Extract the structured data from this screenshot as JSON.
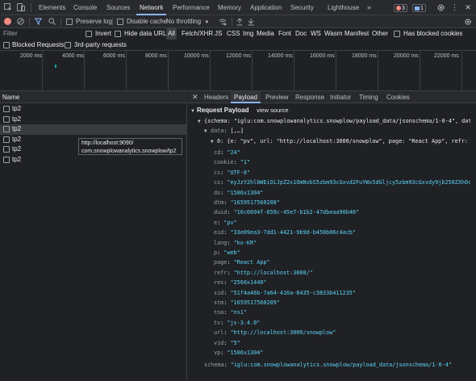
{
  "tabs": [
    "Elements",
    "Console",
    "Sources",
    "Network",
    "Performance",
    "Memory",
    "Application",
    "Security",
    "Lighthouse"
  ],
  "more_tabs": "»",
  "errors_count": "3",
  "messages_count": "1",
  "toolbar": {
    "preserve_log": "Preserve log",
    "disable_cache": "Disable cache",
    "throttling": "No throttling"
  },
  "filter": {
    "placeholder": "Filter",
    "invert": "Invert",
    "hide_data_urls": "Hide data URLs",
    "types": [
      "All",
      "Fetch/XHR",
      "JS",
      "CSS",
      "Img",
      "Media",
      "Font",
      "Doc",
      "WS",
      "Wasm",
      "Manifest",
      "Other"
    ],
    "has_blocked_cookies": "Has blocked cookies",
    "blocked_requests": "Blocked Requests",
    "third_party": "3rd-party requests"
  },
  "timeline_ticks": [
    "2000 ms",
    "4000 ms",
    "6000 ms",
    "8000 ms",
    "10000 ms",
    "12000 ms",
    "14000 ms",
    "16000 ms",
    "18000 ms",
    "20000 ms",
    "22000 ms"
  ],
  "requests": {
    "column_name": "Name",
    "rows": [
      "tp2",
      "tp2",
      "tp2",
      "tp2",
      "tp2",
      "tp2"
    ],
    "tooltip_line1": "http://localhost:9090/",
    "tooltip_line2": "com.snowplowanalytics.snowplow/tp2"
  },
  "detail_tabs": [
    "Headers",
    "Payload",
    "Preview",
    "Response",
    "Initiator",
    "Timing",
    "Cookies"
  ],
  "payload": {
    "section": "Request Payload",
    "view_source": "view source",
    "root_line": "{schema: \"iglu:com.snowplowanalytics.snowplow/payload_data/jsonschema/1-0-4\", data: [,…",
    "data_key": "data",
    "data_summary": "[,…]",
    "item_line": "0: {e: \"pv\", url: \"http://localhost:3000/snowplow\", page: \"React App\", refr: \"http:",
    "fields": [
      {
        "k": "cd",
        "v": "\"24\""
      },
      {
        "k": "cookie",
        "v": "\"1\""
      },
      {
        "k": "cs",
        "v": "\"UTF-8\""
      },
      {
        "k": "cx",
        "v": "\"eyJzY2hlbWEiOiJpZ2x1OmNvbS5zbm93cGxvd2FuYWx5dGljcy5zbm93cGxvdy9jb250ZXh0cy9qc29uc2NoZW1hLzEtMC0wIiwiZGF0YSI6W"
      },
      {
        "k": "ds",
        "v": "\"1586x1304\""
      },
      {
        "k": "dtm",
        "v": "\"1659517560208\""
      },
      {
        "k": "duid",
        "v": "\"16c0694f-659c-45e7-b1b2-47dbeaa90b40\""
      },
      {
        "k": "e",
        "v": "\"pv\""
      },
      {
        "k": "eid",
        "v": "\"33e09ea3-7dd1-4421-9b9d-b450b06c4acb\""
      },
      {
        "k": "lang",
        "v": "\"ko-KR\""
      },
      {
        "k": "p",
        "v": "\"web\""
      },
      {
        "k": "page",
        "v": "\"React App\""
      },
      {
        "k": "refr",
        "v": "\"http://localhost:3000/\""
      },
      {
        "k": "res",
        "v": "\"2560x1440\""
      },
      {
        "k": "sid",
        "v": "\"51f4a46b-7a64-416a-8435-c3833b411235\""
      },
      {
        "k": "stm",
        "v": "\"1659517560209\""
      },
      {
        "k": "tna",
        "v": "\"ns1\""
      },
      {
        "k": "tv",
        "v": "\"js-3.4.0\""
      },
      {
        "k": "url",
        "v": "\"http://localhost:3000/snowplow\""
      },
      {
        "k": "vid",
        "v": "\"5\""
      },
      {
        "k": "vp",
        "v": "\"1586x1304\""
      }
    ],
    "schema_key": "schema",
    "schema_value": "\"iglu:com.snowplowanalytics.snowplow/payload_data/jsonschema/1-0-4\""
  },
  "colors": {
    "accent": "#8ab4f8",
    "record": "#f28b82",
    "value": "#5cd5fb"
  }
}
